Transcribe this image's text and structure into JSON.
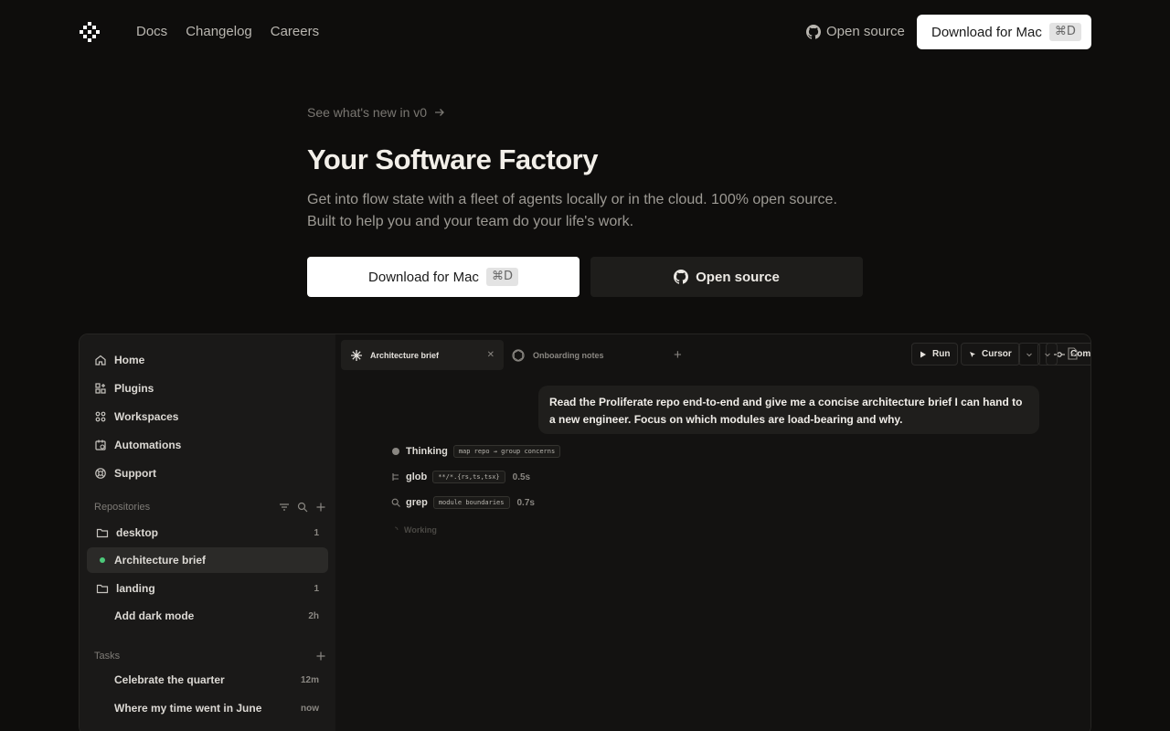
{
  "nav": {
    "links": [
      "Docs",
      "Changelog",
      "Careers"
    ],
    "open_source": "Open source",
    "download": "Download for Mac",
    "download_kbd": "⌘D"
  },
  "hero": {
    "whatsnew": "See what's new in v0",
    "title": "Your Software Factory",
    "sub_line1": "Get into flow state with a fleet of agents locally or in the cloud. 100% open source.",
    "sub_line2": "Built to help you and your team do your life's work.",
    "download": "Download for Mac",
    "download_kbd": "⌘D",
    "open_source": "Open source"
  },
  "sidebar": {
    "items": [
      "Home",
      "Plugins",
      "Workspaces",
      "Automations",
      "Support"
    ],
    "repositories_label": "Repositories",
    "repos": [
      {
        "name": "desktop",
        "count": "1"
      },
      {
        "name": "Architecture brief",
        "count": ""
      },
      {
        "name": "landing",
        "count": "1"
      },
      {
        "name": "Add dark mode",
        "count": "2h"
      }
    ],
    "tasks_label": "Tasks",
    "tasks": [
      {
        "name": "Celebrate the quarter",
        "time": "12m"
      },
      {
        "name": "Where my time went in June",
        "time": "now"
      }
    ]
  },
  "tabs": [
    {
      "label": "Architecture brief"
    },
    {
      "label": "Onboarding notes"
    }
  ],
  "toolbar": {
    "run": "Run",
    "cursor": "Cursor",
    "commit": "Commit"
  },
  "chat": {
    "message_line1": "Read the Proliferate repo end-to-end and give me a concise architecture brief I can hand to",
    "message_line2": "a new engineer. Focus on which modules are load-bearing and why.",
    "steps": [
      {
        "label": "Thinking",
        "code": "map repo → group concerns",
        "duration": ""
      },
      {
        "label": "glob",
        "code": "**/*.{rs,ts,tsx}",
        "duration": "0.5s"
      },
      {
        "label": "grep",
        "code": "module boundaries",
        "duration": "0.7s"
      }
    ],
    "working": "Working"
  }
}
